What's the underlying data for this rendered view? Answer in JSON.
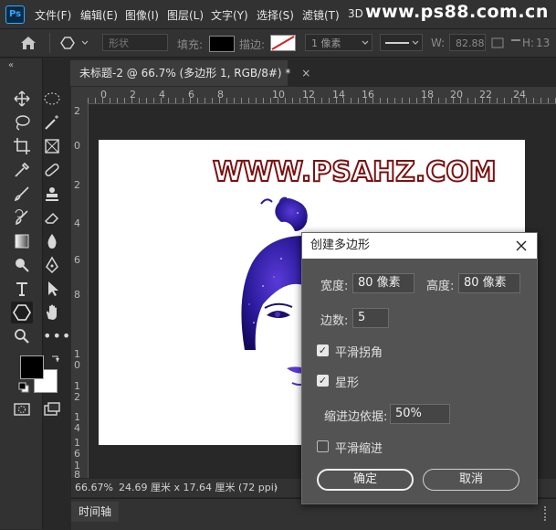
{
  "app": {
    "logo": "Ps"
  },
  "menubar": {
    "items": [
      "文件(F)",
      "编辑(E)",
      "图像(I)",
      "图层(L)",
      "文字(Y)",
      "选择(S)",
      "滤镜(T)",
      "3D"
    ],
    "watermark": "www.ps88.com.cn"
  },
  "options": {
    "mode": "形状",
    "fill_label": "填充:",
    "stroke_label": "描边:",
    "stroke_size": "1 像素",
    "w_label": "W:",
    "w_value": "82.88",
    "h_label": "H:",
    "h_value": "13"
  },
  "tab": {
    "title": "未标题-2 @ 66.7% (多边形 1, RGB/8#) *",
    "close": "×"
  },
  "ruler": {
    "top": [
      "0",
      "2",
      "4",
      "6",
      "8",
      "10",
      "12",
      "14",
      "16",
      "18",
      "20",
      "22",
      "24"
    ],
    "left": [
      "2",
      "0",
      "2",
      "4",
      "6",
      "8",
      "1",
      "0",
      "1",
      "2",
      "1",
      "4",
      "1",
      "6",
      "1",
      "8"
    ]
  },
  "canvas": {
    "headline": "WWW.PSAHZ.COM"
  },
  "status": {
    "zoom": "66.67%",
    "doc_info": "24.69 厘米 x 17.64 厘米 (72 ppi)",
    "arrow": "›"
  },
  "timeline": {
    "label": "时间轴"
  },
  "dialog": {
    "title": "创建多边形",
    "width_label": "宽度:",
    "width_value": "80 像素",
    "height_label": "高度:",
    "height_value": "80 像素",
    "sides_label": "边数:",
    "sides_value": "5",
    "smooth_corners_label": "平滑拐角",
    "smooth_corners_checked": true,
    "star_label": "星形",
    "star_checked": true,
    "indent_label": "缩进边依据:",
    "indent_value": "50%",
    "smooth_indent_label": "平滑缩进",
    "smooth_indent_checked": false,
    "ok_label": "确定",
    "cancel_label": "取消"
  },
  "colors": {
    "accent": "#31a8ff",
    "headline_outline": "#7a1010",
    "foreground": "#000000",
    "background": "#ffffff"
  }
}
